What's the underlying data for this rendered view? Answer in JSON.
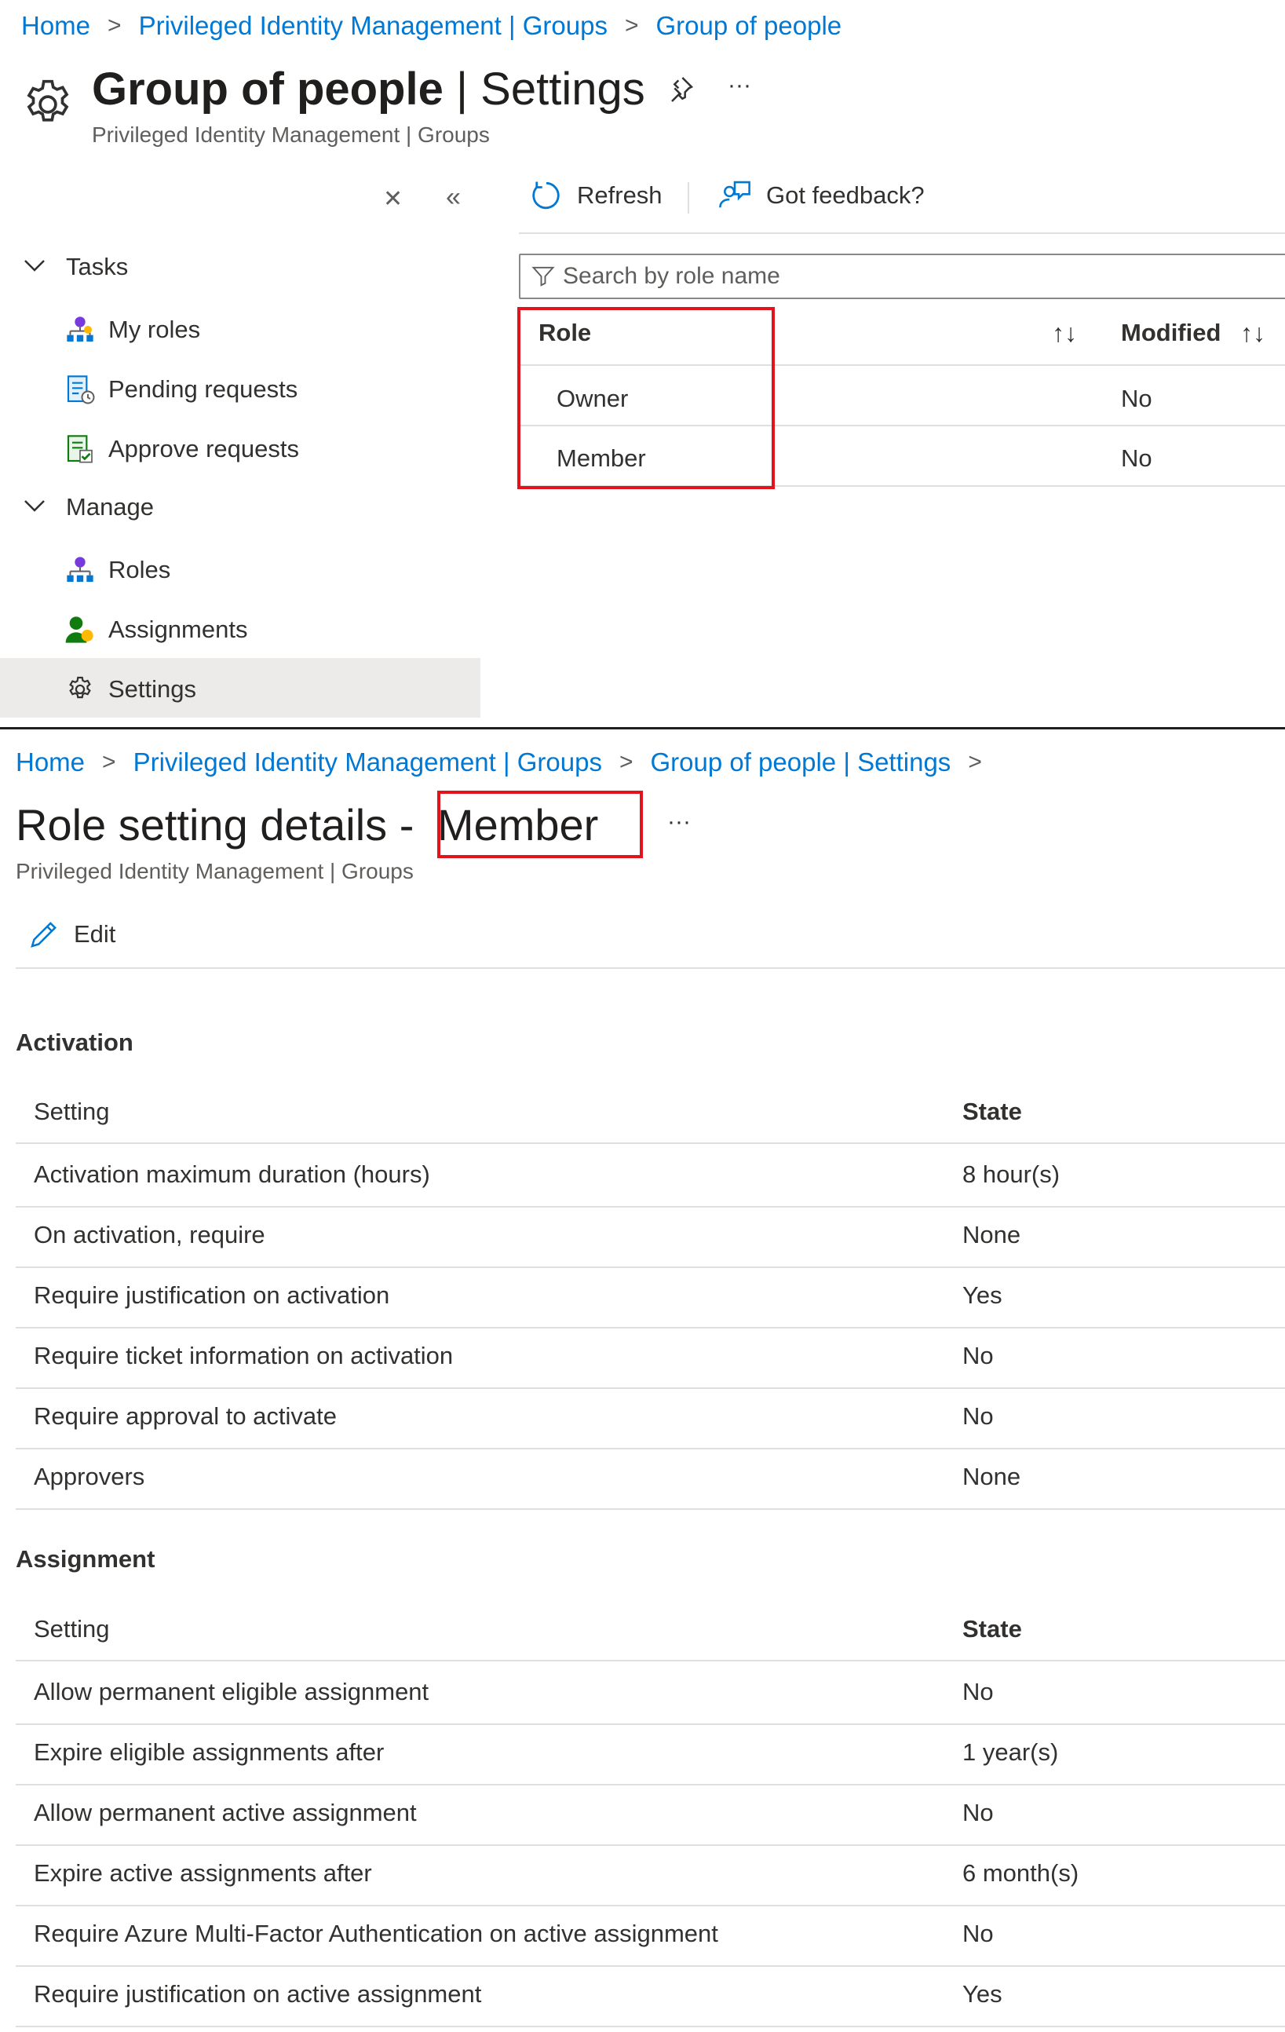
{
  "top": {
    "breadcrumb": [
      "Home",
      "Privileged Identity Management | Groups",
      "Group of people"
    ],
    "title_main": "Group of people",
    "title_sep": " | ",
    "title_sub": "Settings",
    "subtitle": "Privileged Identity Management | Groups",
    "more": "···",
    "toolbar": {
      "refresh": "Refresh",
      "feedback": "Got feedback?"
    },
    "search_placeholder": "Search by role name",
    "sidebar": {
      "tasks_label": "Tasks",
      "manage_label": "Manage",
      "tasks": [
        {
          "label": "My roles",
          "icon": "my-roles-icon"
        },
        {
          "label": "Pending requests",
          "icon": "pending-requests-icon"
        },
        {
          "label": "Approve requests",
          "icon": "approve-requests-icon"
        }
      ],
      "manage": [
        {
          "label": "Roles",
          "icon": "roles-icon"
        },
        {
          "label": "Assignments",
          "icon": "assignments-icon"
        },
        {
          "label": "Settings",
          "icon": "gear-icon"
        }
      ]
    },
    "table": {
      "col_role": "Role",
      "col_modified": "Modified",
      "rows": [
        {
          "role": "Owner",
          "modified": "No"
        },
        {
          "role": "Member",
          "modified": "No"
        }
      ]
    }
  },
  "bottom": {
    "breadcrumb": [
      "Home",
      "Privileged Identity Management | Groups",
      "Group of people | Settings"
    ],
    "title_prefix": "Role setting details - ",
    "title_role": "Member",
    "more": "···",
    "subtitle": "Privileged Identity Management | Groups",
    "edit": "Edit",
    "activation": {
      "heading": "Activation",
      "col_setting": "Setting",
      "col_state": "State",
      "rows": [
        {
          "setting": "Activation maximum duration (hours)",
          "state": "8 hour(s)"
        },
        {
          "setting": "On activation, require",
          "state": "None"
        },
        {
          "setting": "Require justification on activation",
          "state": "Yes"
        },
        {
          "setting": "Require ticket information on activation",
          "state": "No"
        },
        {
          "setting": "Require approval to activate",
          "state": "No"
        },
        {
          "setting": "Approvers",
          "state": "None"
        }
      ]
    },
    "assignment": {
      "heading": "Assignment",
      "col_setting": "Setting",
      "col_state": "State",
      "rows": [
        {
          "setting": "Allow permanent eligible assignment",
          "state": "No"
        },
        {
          "setting": "Expire eligible assignments after",
          "state": "1 year(s)"
        },
        {
          "setting": "Allow permanent active assignment",
          "state": "No"
        },
        {
          "setting": "Expire active assignments after",
          "state": "6 month(s)"
        },
        {
          "setting": "Require Azure Multi-Factor Authentication on active assignment",
          "state": "No"
        },
        {
          "setting": "Require justification on active assignment",
          "state": "Yes"
        }
      ]
    }
  }
}
